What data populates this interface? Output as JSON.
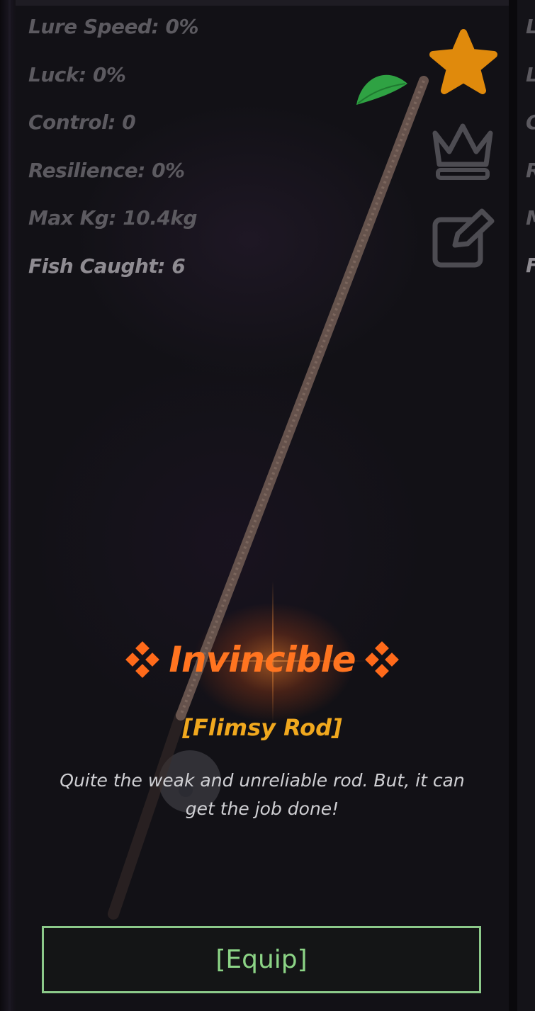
{
  "stats": [
    {
      "label": "Lure Speed: 0%"
    },
    {
      "label": "Luck: 0%"
    },
    {
      "label": "Control: 0"
    },
    {
      "label": "Resilience: 0%"
    },
    {
      "label": "Max Kg: 10.4kg"
    },
    {
      "label": "Fish Caught: 6"
    }
  ],
  "next_card_peek": [
    "L",
    "L",
    "C",
    "R",
    "M",
    "F"
  ],
  "icons": {
    "favorite": "star-icon",
    "favorite_color": "#e08a0c",
    "rank": "crown-icon",
    "rename": "edit-icon"
  },
  "rod": {
    "rarity": "Invincible",
    "rarity_color": "#ff7420",
    "name": "[Flimsy Rod]",
    "name_color": "#f0a81e",
    "description": "Quite the weak and unreliable rod. But, it can get the job done!"
  },
  "equip_button": {
    "label": "[Equip]",
    "color": "#8cd486"
  }
}
